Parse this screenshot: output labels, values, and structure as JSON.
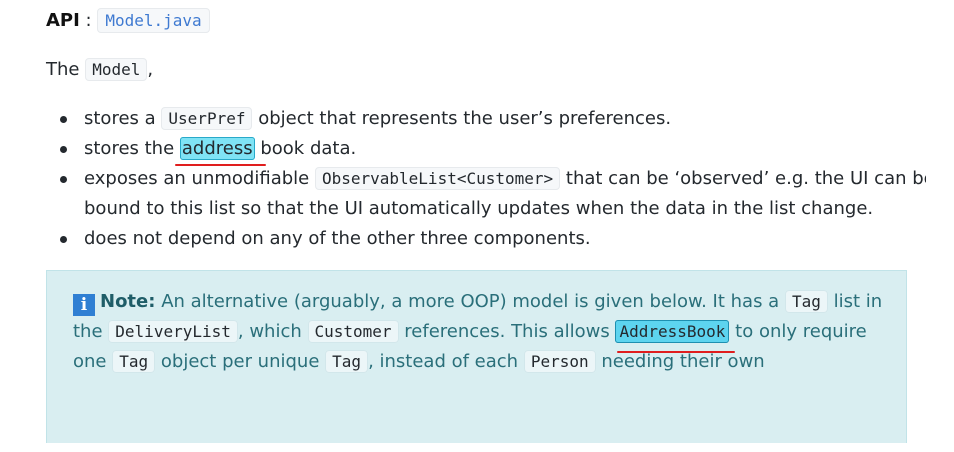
{
  "api": {
    "label": "API",
    "separator": " : ",
    "link": "Model.java"
  },
  "intro": {
    "prefix": "The",
    "code": "Model",
    "suffix": ","
  },
  "bullets": [
    {
      "pre": "stores a",
      "code": "UserPref",
      "post": "object that represents the user’s preferences."
    },
    {
      "pre": "stores the",
      "highlight": "address",
      "post": "book data."
    },
    {
      "pre": "exposes an unmodifiable",
      "code": "ObservableList<Customer>",
      "post": "that can be ‘observed’ e.g. the UI can be bound to this list so that the UI automatically updates when the data in the list change."
    },
    {
      "text": "does not depend on any of the other three components."
    }
  ],
  "note": {
    "icon": "info-icon",
    "label": "Note:",
    "t1": "An alternative (arguably, a more OOP) model is given below. It has a",
    "c1": "Tag",
    "t2": "list in the",
    "c2": "DeliveryList",
    "t3": ", which",
    "c3": "Customer",
    "t4": "references. This allows",
    "c4": "AddressBook",
    "t5": "to only require one",
    "c5": "Tag",
    "t6": "object per unique",
    "c6": "Tag",
    "t7": ", instead of each",
    "c7": "Person",
    "t8": "needing their own"
  },
  "colors": {
    "highlight": "#7fe3f5",
    "annotation_underline": "#e01e1e",
    "note_background": "#d9eef1",
    "link": "#3f7ad1"
  }
}
